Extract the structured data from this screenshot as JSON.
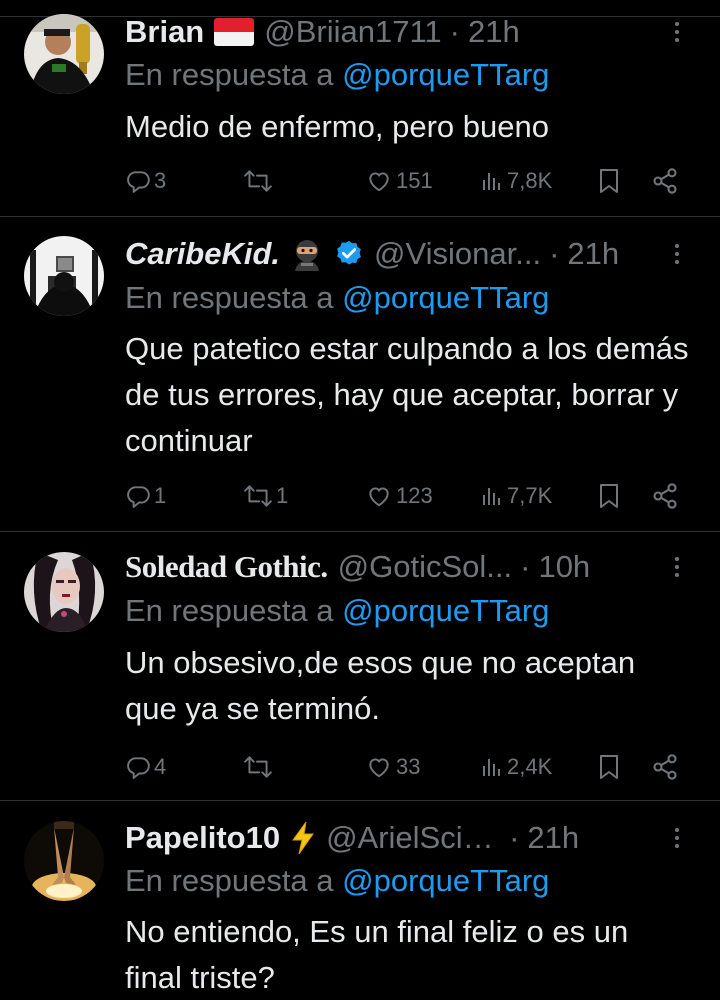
{
  "tweets": [
    {
      "name": "Brian",
      "emoji": "flag-indonesia",
      "handle": "@Briian1711",
      "time": "21h",
      "reply_prefix": "En respuesta a ",
      "reply_mention": "@porqueTTarg",
      "text": "Medio de enfermo, pero bueno",
      "replies": "3",
      "retweets": "",
      "likes": "151",
      "views": "7,8K"
    },
    {
      "name": "CaribeKid.",
      "emoji": "ninja-emoji",
      "verified": true,
      "handle": "@Visionar...",
      "time": "21h",
      "reply_prefix": "En respuesta a ",
      "reply_mention": "@porqueTTarg",
      "text": "Que patetico estar culpando a los demás de tus errores, hay que aceptar, borrar y continuar",
      "replies": "1",
      "retweets": "1",
      "likes": "123",
      "views": "7,7K"
    },
    {
      "name": "Soledad Gothic.",
      "handle": "@GoticSol...",
      "time": "10h",
      "reply_prefix": "En respuesta a ",
      "reply_mention": "@porqueTTarg",
      "text": "Un obsesivo,de esos que no aceptan que ya se terminó.",
      "replies": "4",
      "retweets": "",
      "likes": "33",
      "views": "2,4K"
    },
    {
      "name": "Papelito10",
      "emoji": "lightning-emoji",
      "handle": "@ArielScini...",
      "time": "21h",
      "reply_prefix": "En respuesta a ",
      "reply_mention": "@porqueTTarg",
      "text": "No entiendo, Es un final feliz o es un final triste?"
    }
  ],
  "separator": "·",
  "colors": {
    "background": "#000000",
    "text": "#e7e9ea",
    "muted": "#71767b",
    "link": "#1d9bf0",
    "border": "#2f3336"
  },
  "icons": [
    "reply-icon",
    "retweet-icon",
    "like-icon",
    "views-icon",
    "bookmark-icon",
    "share-icon",
    "more-icon",
    "verified-badge-icon"
  ]
}
